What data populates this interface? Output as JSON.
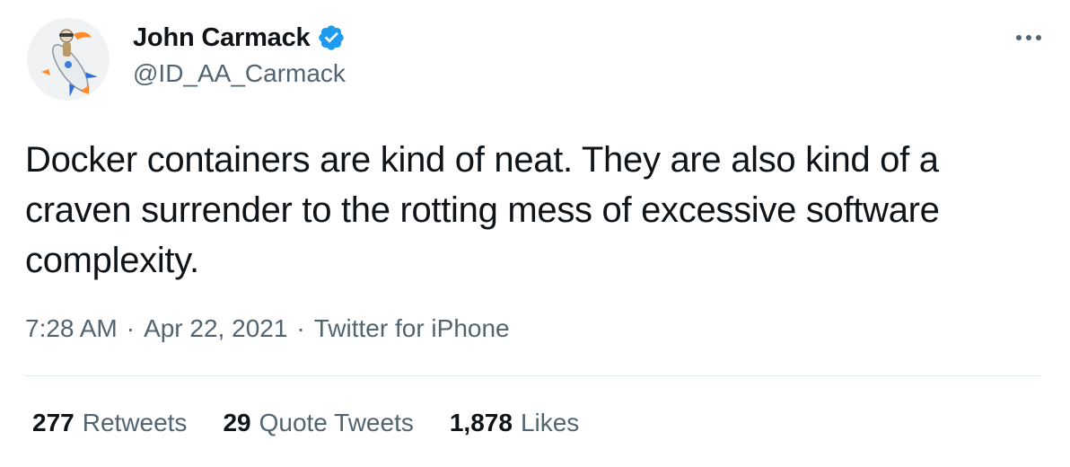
{
  "author": {
    "display_name": "John Carmack",
    "handle": "@ID_AA_Carmack",
    "verified": true,
    "verified_color": "#1d9bf0"
  },
  "tweet": {
    "text": "Docker containers are kind of neat. They are also kind of a craven surrender to the rotting mess of excessive software complexity.",
    "time": "7:28 AM",
    "date": "Apr 22, 2021",
    "source": "Twitter for iPhone",
    "separator": "·"
  },
  "stats": {
    "retweets": {
      "count": "277",
      "label": "Retweets"
    },
    "quote_tweets": {
      "count": "29",
      "label": "Quote Tweets"
    },
    "likes": {
      "count": "1,878",
      "label": "Likes"
    }
  },
  "icons": {
    "more": "more-horizontal-icon",
    "verified": "verified-badge-icon"
  },
  "colors": {
    "text_primary": "#0f1419",
    "text_secondary": "#536471",
    "divider": "#e1e8ed"
  }
}
